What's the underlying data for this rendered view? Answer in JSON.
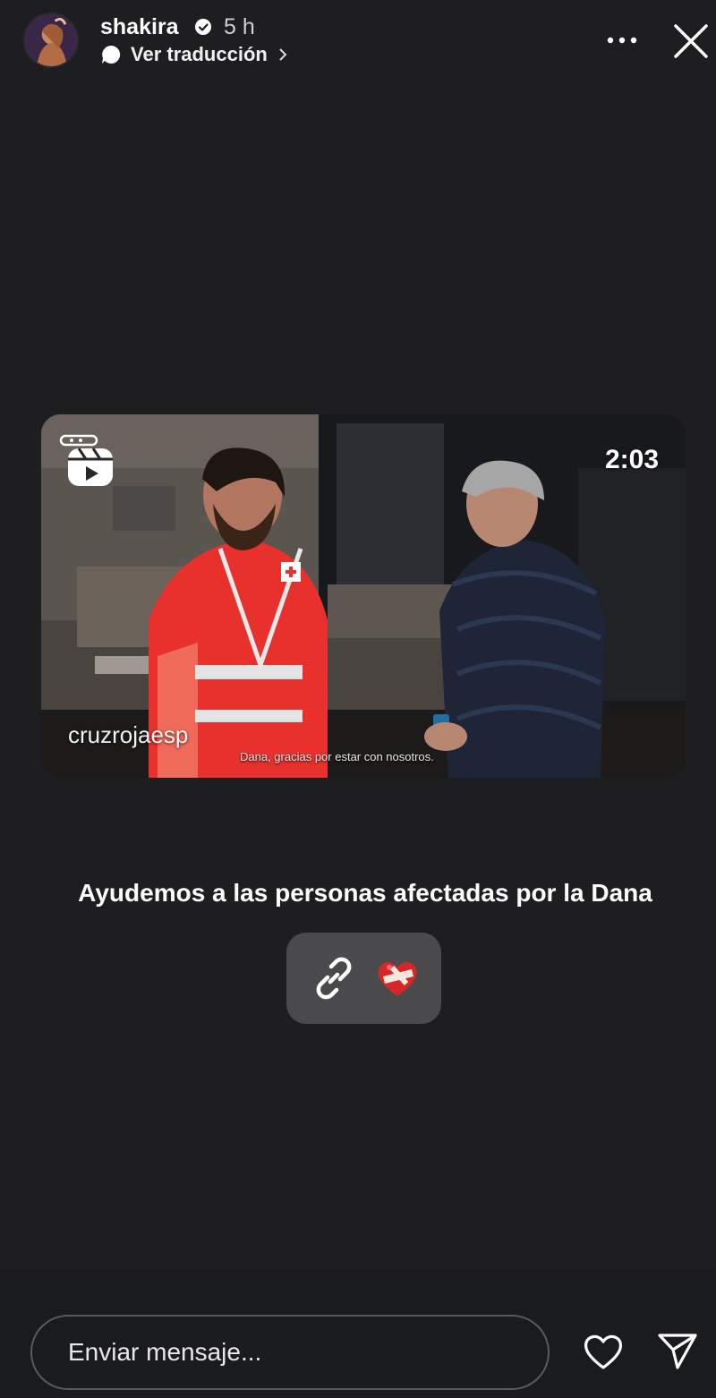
{
  "header": {
    "username": "shakira",
    "time_ago": "5 h",
    "translate_label": "Ver traducción"
  },
  "video": {
    "duration": "2:03",
    "source": "cruzrojaesp",
    "subtitle": "Dana, gracias por estar con nosotros."
  },
  "caption": "Ayudemos a las personas afectadas por la Dana",
  "link_sticker": {
    "icons": [
      "link-icon",
      "heart-bandage-icon"
    ]
  },
  "footer": {
    "message_placeholder": "Enviar mensaje..."
  },
  "colors": {
    "background": "#1e1e21",
    "sticker": "#4a4a4d",
    "vest_red": "#e8302c"
  }
}
